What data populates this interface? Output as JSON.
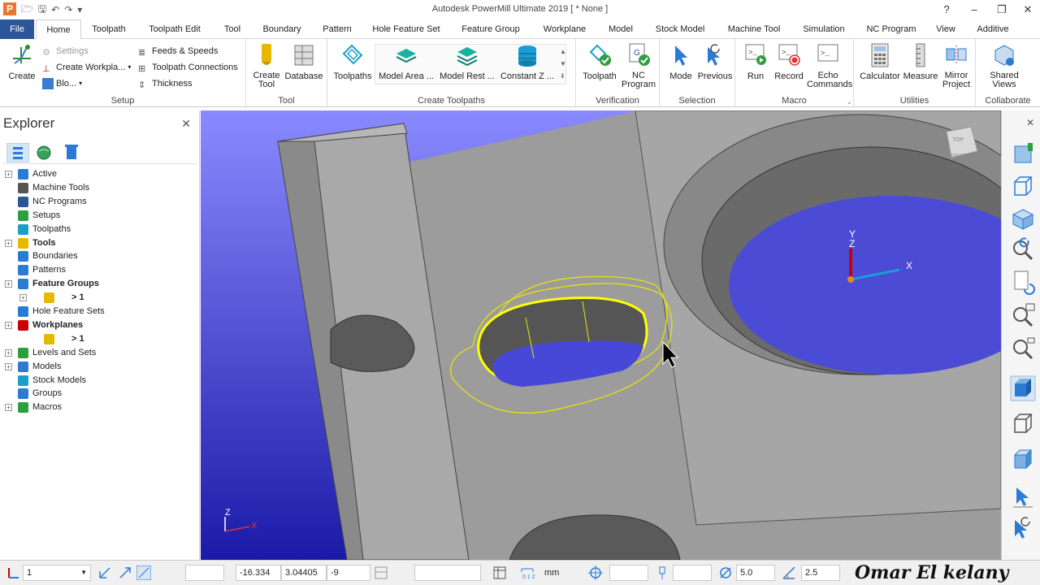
{
  "window": {
    "logo_letter": "P",
    "title": "Autodesk PowerMill Ultimate 2019   [ * None ]"
  },
  "tabs": [
    "File",
    "Home",
    "Toolpath",
    "Toolpath Edit",
    "Tool",
    "Boundary",
    "Pattern",
    "Hole Feature Set",
    "Feature Group",
    "Workplane",
    "Model",
    "Stock Model",
    "Machine Tool",
    "Simulation",
    "NC Program",
    "View",
    "Additive"
  ],
  "ribbon": {
    "setup": {
      "label": "Setup",
      "create": "Create",
      "settings": "Settings",
      "create_workplane": "Create Workpla...",
      "block": "Blo...",
      "feeds_speeds": "Feeds & Speeds",
      "toolpath_connections": "Toolpath Connections",
      "thickness": "Thickness"
    },
    "tool": {
      "label": "Tool",
      "create_tool": "Create\nTool",
      "database": "Database"
    },
    "create_toolpaths": {
      "label": "Create Toolpaths",
      "toolpaths": "Toolpaths",
      "model_area": "Model Area ...",
      "model_rest": "Model Rest ...",
      "constant_z": "Constant Z ..."
    },
    "verification": {
      "label": "Verification",
      "toolpath": "Toolpath",
      "nc_program": "NC\nProgram"
    },
    "selection": {
      "label": "Selection",
      "mode": "Mode",
      "previous": "Previous"
    },
    "macro": {
      "label": "Macro",
      "run": "Run",
      "record": "Record",
      "echo_commands": "Echo\nCommands"
    },
    "utilities": {
      "label": "Utilities",
      "calculator": "Calculator",
      "measure": "Measure",
      "mirror_project": "Mirror\nProject"
    },
    "collaborate": {
      "label": "Collaborate",
      "shared_views": "Shared\nViews"
    }
  },
  "explorer": {
    "title": "Explorer",
    "items": [
      {
        "label": "Active",
        "bold": false,
        "indent": 0,
        "expander": true
      },
      {
        "label": "Machine Tools",
        "bold": false,
        "indent": 0,
        "expander": false
      },
      {
        "label": "NC Programs",
        "bold": false,
        "indent": 0,
        "expander": false
      },
      {
        "label": "Setups",
        "bold": false,
        "indent": 0,
        "expander": false
      },
      {
        "label": "Toolpaths",
        "bold": false,
        "indent": 0,
        "expander": false
      },
      {
        "label": "Tools",
        "bold": true,
        "indent": 0,
        "expander": true
      },
      {
        "label": "Boundaries",
        "bold": false,
        "indent": 0,
        "expander": false
      },
      {
        "label": "Patterns",
        "bold": false,
        "indent": 0,
        "expander": false
      },
      {
        "label": "Feature Groups",
        "bold": true,
        "indent": 0,
        "expander": true
      },
      {
        "label": "> 1",
        "bold": true,
        "indent": 1,
        "expander": true
      },
      {
        "label": "Hole Feature Sets",
        "bold": false,
        "indent": 0,
        "expander": false
      },
      {
        "label": "Workplanes",
        "bold": true,
        "indent": 0,
        "expander": true
      },
      {
        "label": "> 1",
        "bold": true,
        "indent": 1,
        "expander": false
      },
      {
        "label": "Levels and Sets",
        "bold": false,
        "indent": 0,
        "expander": true
      },
      {
        "label": "Models",
        "bold": false,
        "indent": 0,
        "expander": true
      },
      {
        "label": "Stock Models",
        "bold": false,
        "indent": 0,
        "expander": false
      },
      {
        "label": "Groups",
        "bold": false,
        "indent": 0,
        "expander": false
      },
      {
        "label": "Macros",
        "bold": false,
        "indent": 0,
        "expander": true
      }
    ]
  },
  "viewport": {
    "axis_y": "Y",
    "axis_z": "Z",
    "axis_x": "X",
    "mini_z": "Z",
    "mini_x": "X",
    "cube_top": "TOP",
    "cube_front": "FRONT"
  },
  "status": {
    "workplane_value": "1",
    "x": "-16.334",
    "y": "3.04405",
    "z": "-9",
    "units": "mm",
    "diameter": "5.0",
    "tolerance": "2.5",
    "signature": "Omar    El kelany"
  },
  "colors": {
    "file_tab": "#2b579a",
    "viewport_bg": "#4040d0",
    "selection": "#ffff00"
  }
}
